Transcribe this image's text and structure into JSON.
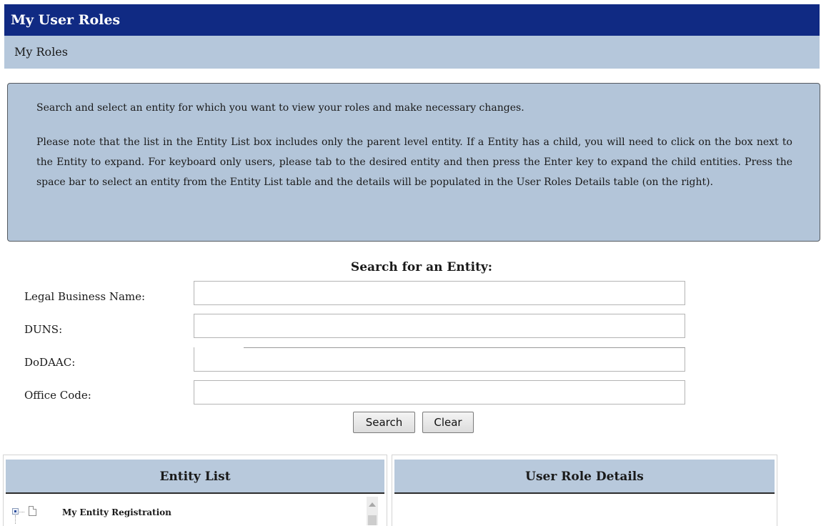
{
  "header": {
    "title": "My User Roles",
    "subtitle": "My Roles"
  },
  "info": {
    "line1": "Search and select an entity for which you want to view your roles and make necessary changes.",
    "line2": "Please note that the list in the Entity List box includes only the parent level entity. If a Entity has a child, you will need to click on the box next to the Entity to expand. For keyboard only users, please tab to the desired entity and then press the Enter key to expand the child entities. Press the space bar to select an entity from the Entity List table and the details will be populated in the User Roles Details table (on the right)."
  },
  "search": {
    "title": "Search for an Entity:",
    "fields": [
      {
        "label": "Legal Business Name:",
        "value": ""
      },
      {
        "label": "DUNS:",
        "value": ""
      },
      {
        "label": "DoDAAC:",
        "value": ""
      },
      {
        "label": "Office Code:",
        "value": ""
      }
    ],
    "search_button": "Search",
    "clear_button": "Clear"
  },
  "entity_list": {
    "header": "Entity List",
    "items": [
      {
        "label": "My Entity Registration"
      }
    ]
  },
  "role_details": {
    "header": "User Role Details"
  },
  "colors": {
    "title_bar": "#102a83",
    "sub_bar": "#b5c7db",
    "info_box": "#b3c5d9",
    "panel_header": "#b8c9dc"
  },
  "icons": {
    "expander": "tree-expand-icon",
    "document": "document-icon",
    "scroll_up": "scroll-up-arrow-icon"
  }
}
